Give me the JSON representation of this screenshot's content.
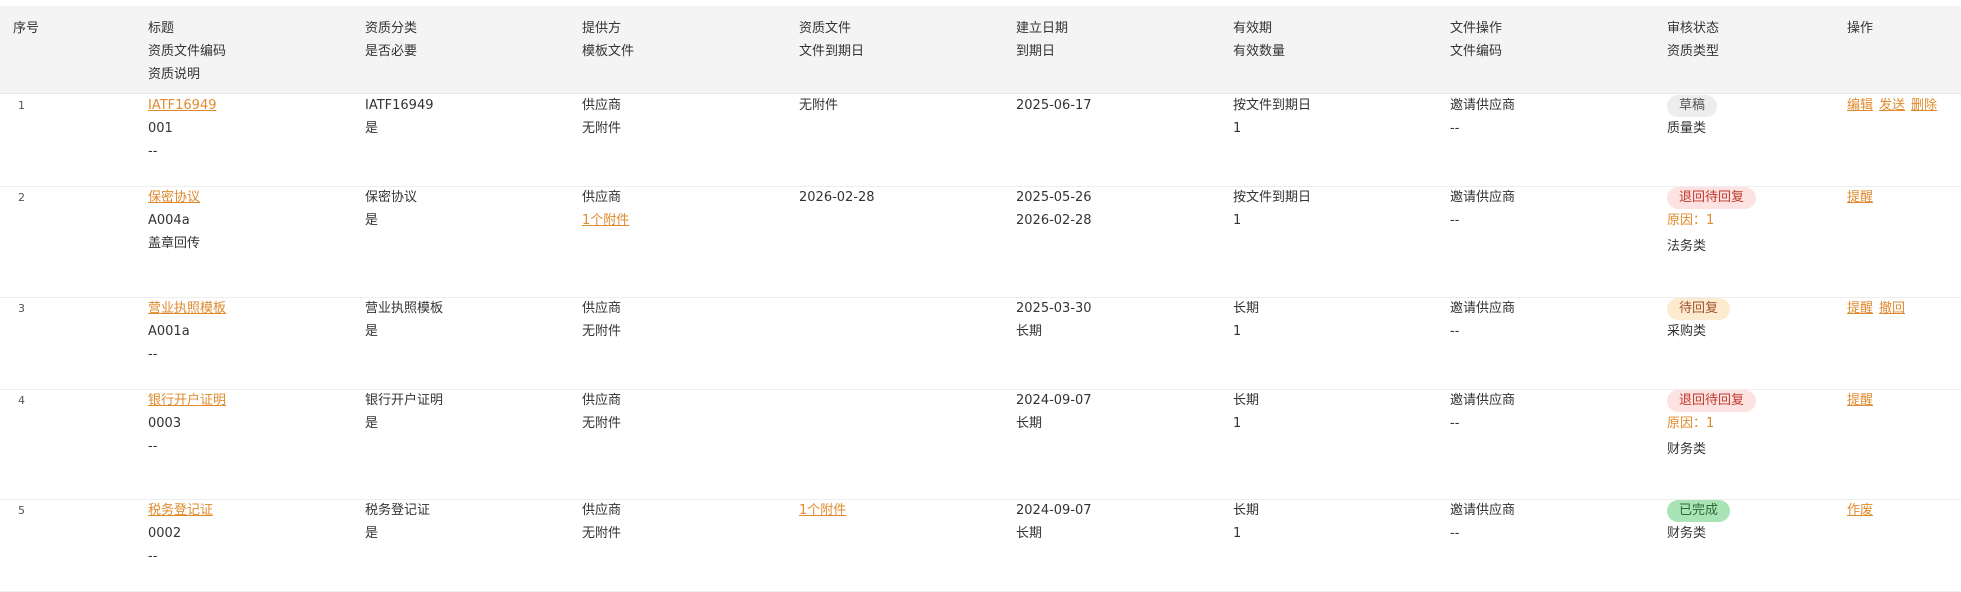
{
  "header": {
    "seq": "序号",
    "title": [
      "标题",
      "资质文件编码",
      "资质说明"
    ],
    "category": [
      "资质分类",
      "是否必要"
    ],
    "provider": [
      "提供方",
      "模板文件"
    ],
    "doc": [
      "资质文件",
      "文件到期日"
    ],
    "date": [
      "建立日期",
      "到期日"
    ],
    "validity": [
      "有效期",
      "有效数量"
    ],
    "fileop": [
      "文件操作",
      "文件编码"
    ],
    "status": [
      "审核状态",
      "资质类型"
    ],
    "ops": "操作"
  },
  "rows": [
    {
      "seq": "1",
      "title": "IATF16949",
      "code": "001",
      "desc": "--",
      "category": "IATF16949",
      "required": "是",
      "provider": "供应商",
      "template": "无附件",
      "template_link": false,
      "doc": "无附件",
      "doc_link": false,
      "doc_expiry": "",
      "created": "2025-06-17",
      "expiry": "",
      "validity": "按文件到期日",
      "count": "1",
      "fileop": "邀请供应商",
      "filecode": "--",
      "status": "草稿",
      "status_kind": "draft",
      "reason": "",
      "type": "质量类",
      "ops": [
        "编辑",
        "发送",
        "删除"
      ]
    },
    {
      "seq": "2",
      "title": "保密协议",
      "code": "A004a",
      "desc": "盖章回传",
      "category": "保密协议",
      "required": "是",
      "provider": "供应商",
      "template": "1个附件",
      "template_link": true,
      "doc": "2026-02-28",
      "doc_link": false,
      "doc_expiry": "",
      "created": "2025-05-26",
      "expiry": "2026-02-28",
      "validity": "按文件到期日",
      "count": "1",
      "fileop": "邀请供应商",
      "filecode": "--",
      "status": "退回待回复",
      "status_kind": "returned",
      "reason": "原因：1",
      "type": "法务类",
      "ops": [
        "提醒"
      ]
    },
    {
      "seq": "3",
      "title": "营业执照模板",
      "code": "A001a",
      "desc": "--",
      "category": "营业执照模板",
      "required": "是",
      "provider": "供应商",
      "template": "无附件",
      "template_link": false,
      "doc": "",
      "doc_link": false,
      "doc_expiry": "",
      "created": "2025-03-30",
      "expiry": "长期",
      "validity": "长期",
      "count": "1",
      "fileop": "邀请供应商",
      "filecode": "--",
      "status": "待回复",
      "status_kind": "pending",
      "reason": "",
      "type": "采购类",
      "ops": [
        "提醒",
        "撤回"
      ]
    },
    {
      "seq": "4",
      "title": "银行开户证明",
      "code": "0003",
      "desc": "--",
      "category": "银行开户证明",
      "required": "是",
      "provider": "供应商",
      "template": "无附件",
      "template_link": false,
      "doc": "",
      "doc_link": false,
      "doc_expiry": "",
      "created": "2024-09-07",
      "expiry": "长期",
      "validity": "长期",
      "count": "1",
      "fileop": "邀请供应商",
      "filecode": "--",
      "status": "退回待回复",
      "status_kind": "returned",
      "reason": "原因：1",
      "type": "财务类",
      "ops": [
        "提醒"
      ]
    },
    {
      "seq": "5",
      "title": "税务登记证",
      "code": "0002",
      "desc": "--",
      "category": "税务登记证",
      "required": "是",
      "provider": "供应商",
      "template": "无附件",
      "template_link": false,
      "doc": "1个附件",
      "doc_link": true,
      "doc_expiry": "",
      "created": "2024-09-07",
      "expiry": "长期",
      "validity": "长期",
      "count": "1",
      "fileop": "邀请供应商",
      "filecode": "--",
      "status": "已完成",
      "status_kind": "done",
      "reason": "",
      "type": "财务类",
      "ops": [
        "作废"
      ]
    }
  ]
}
